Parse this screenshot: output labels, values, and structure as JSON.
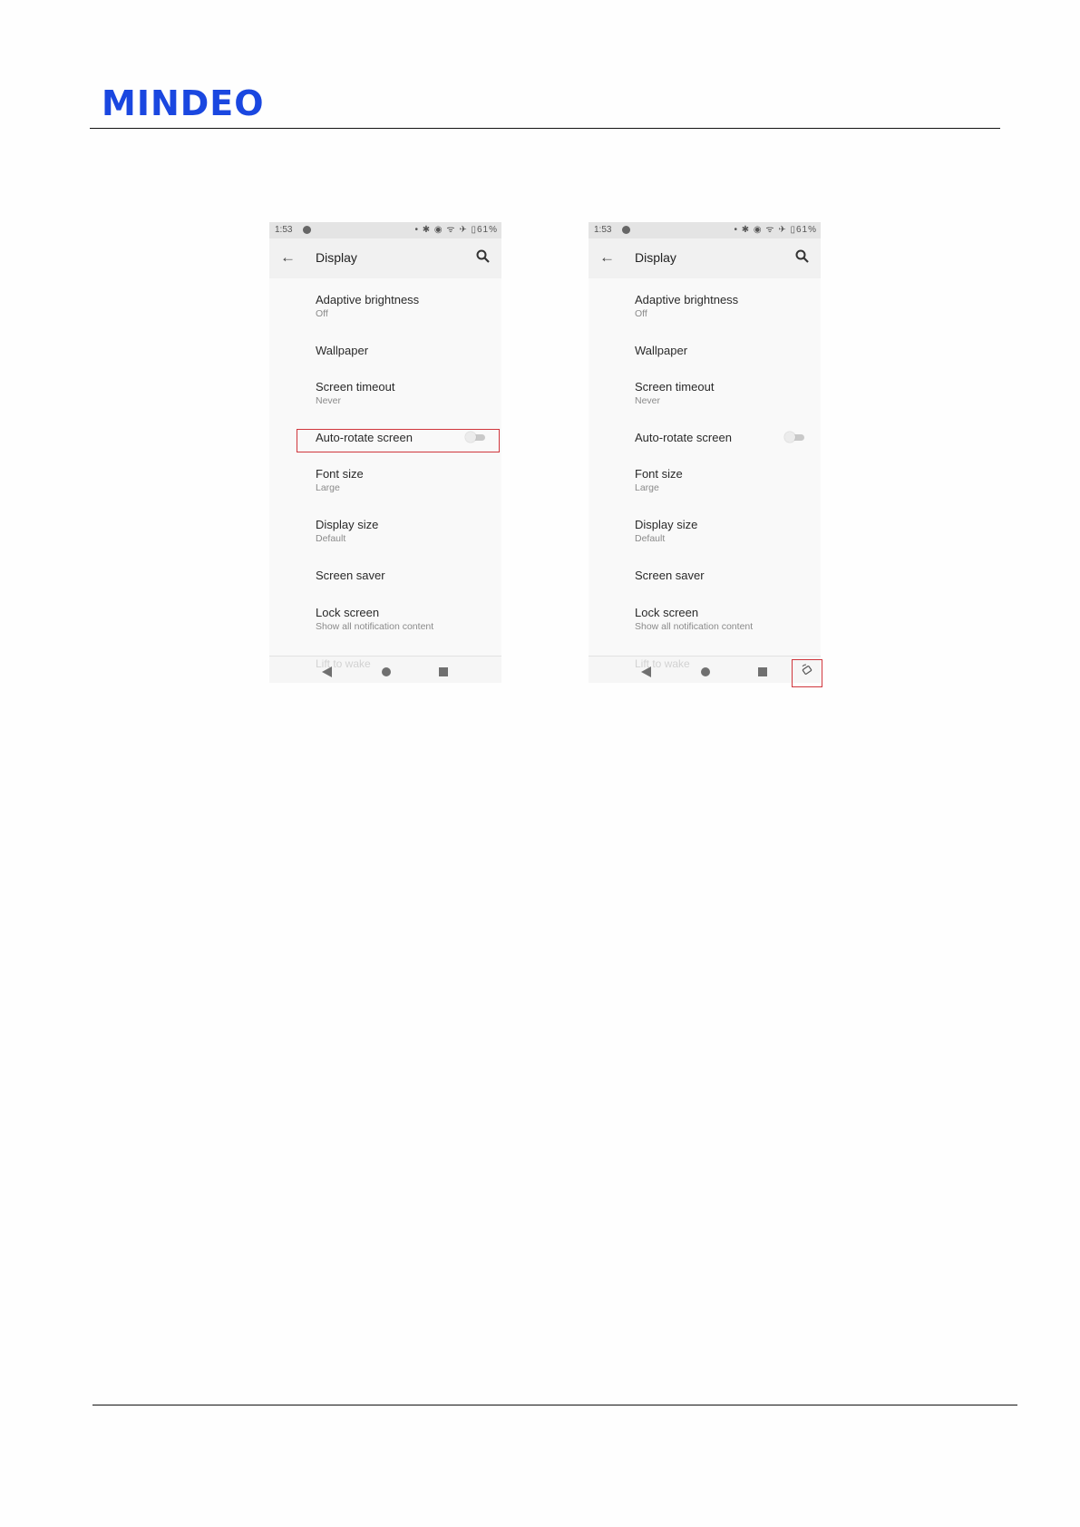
{
  "logo": {
    "text": "MINDEO",
    "color": "#1a47e0"
  },
  "phones": [
    {
      "status": {
        "time": "1:53",
        "icons": "• ✱ ◉ ᯤ ✈ ▯61%"
      },
      "appbar": {
        "back_icon": "←",
        "title": "Display"
      },
      "items": [
        {
          "label": "Adaptive brightness",
          "sub": "Off"
        },
        {
          "label": "Wallpaper"
        },
        {
          "label": "Screen timeout",
          "sub": "Never"
        },
        {
          "label": "Auto-rotate screen",
          "toggle": "off"
        },
        {
          "label": "Font size",
          "sub": "Large"
        },
        {
          "label": "Display size",
          "sub": "Default"
        },
        {
          "label": "Screen saver"
        },
        {
          "label": "Lock screen",
          "sub": "Show all notification content"
        },
        {
          "label": "Lift to wake"
        }
      ]
    },
    {
      "status": {
        "time": "1:53",
        "icons": "• ✱ ◉ ᯤ ✈ ▯61%"
      },
      "appbar": {
        "back_icon": "←",
        "title": "Display"
      },
      "items": [
        {
          "label": "Adaptive brightness",
          "sub": "Off"
        },
        {
          "label": "Wallpaper"
        },
        {
          "label": "Screen timeout",
          "sub": "Never"
        },
        {
          "label": "Auto-rotate screen",
          "toggle": "off"
        },
        {
          "label": "Font size",
          "sub": "Large"
        },
        {
          "label": "Display size",
          "sub": "Default"
        },
        {
          "label": "Screen saver"
        },
        {
          "label": "Lock screen",
          "sub": "Show all notification content"
        },
        {
          "label": "Lift to wake"
        }
      ],
      "navbar_extra_icon": "rotate-icon"
    }
  ],
  "highlight_color": "#d0363c"
}
